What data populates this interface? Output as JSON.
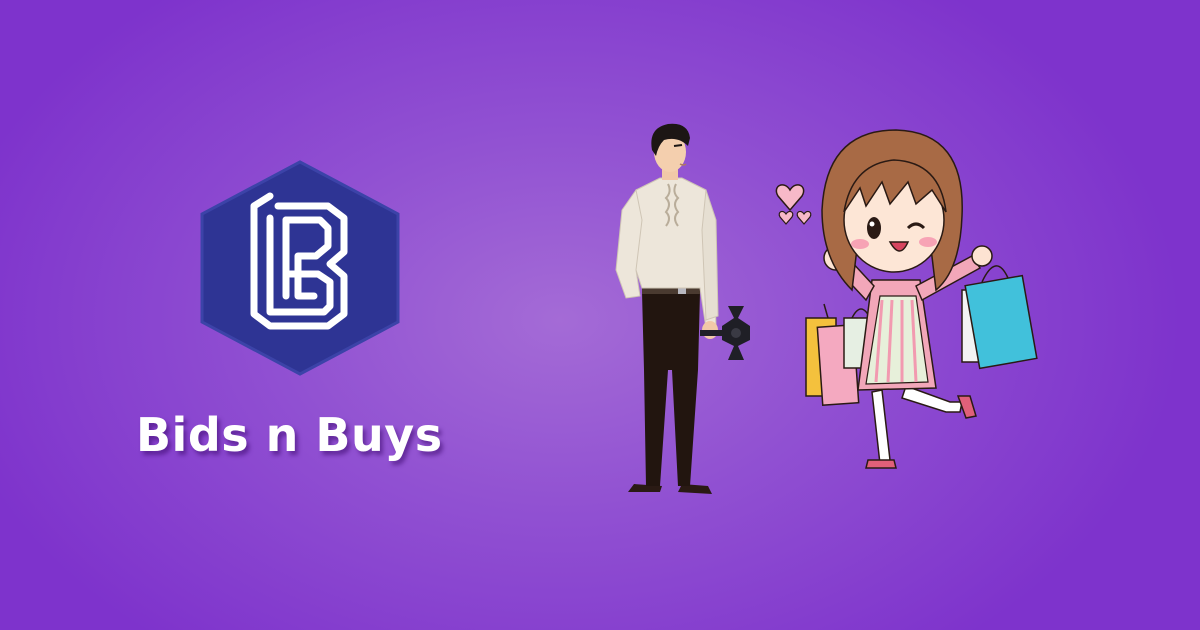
{
  "brand": {
    "name": "Bids n Buys",
    "logo_icon": "bnb-hexagon-logo-icon"
  },
  "illustration": {
    "characters": [
      "seller-man-icon",
      "shopper-girl-icon"
    ],
    "props": [
      "gavel-icon",
      "shopping-bags-icon",
      "hearts-icon"
    ]
  },
  "colors": {
    "background": "#8a45cf",
    "logo_hex": "#2e3494",
    "logo_mark": "#ffffff",
    "brand_text": "#ffffff"
  }
}
